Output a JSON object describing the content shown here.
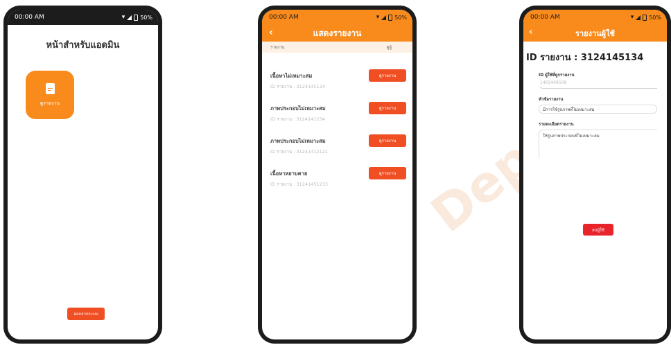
{
  "status_bar": {
    "time": "00:00 AM",
    "battery": "50%"
  },
  "screen1": {
    "title": "หน้าสำหรับแอดมิน",
    "tile_label": "ดูรายงาน",
    "logout_label": "ออกจากระบบ"
  },
  "screen2": {
    "title": "แสดงรายงาน",
    "back": "‹",
    "col_left": "รายงาน",
    "col_right": "ดูผู้",
    "reports": [
      {
        "title": "เนื้อหาไม่เหมาะสม",
        "id": "ID รายงาน : 3124145134",
        "button": "ดูรายงาน"
      },
      {
        "title": "ภาพประกอบไม่เหมาะสม",
        "id": "ID รายงาน : 3124141234",
        "button": "ดูรายงาน"
      },
      {
        "title": "ภาพประกอบไม่เหมาะสม",
        "id": "ID รายงาน : 31241412121",
        "button": "ดูรายงาน"
      },
      {
        "title": "เนื้อหาหยาบคาย",
        "id": "ID รายงาน : 31241451233",
        "button": "ดูรายงาน"
      }
    ]
  },
  "screen3": {
    "title": "รายงานผู้ใช้",
    "back": "‹",
    "heading": "ID รายงาน : 3124145134",
    "reported_user_label": "ID ผู้ใช้ที่ถูกรายงาน",
    "reported_user_value": "1403409508",
    "subject_label": "หัวข้อรายงาน",
    "subject_value": "มีการใช้รูปภาพที่ไม่เหมาะสม",
    "details_label": "รายละเอียดรายงาน",
    "details_value": "ใช้รูปภาพประกอบที่ไม่เหมาะสม",
    "ban_button": "ลบผู้ใช้"
  },
  "watermark": {
    "line1": "Department",
    "line2": "University"
  },
  "colors": {
    "orange": "#f98b1d",
    "button_red": "#f04e23",
    "ban_red": "#e8232a"
  }
}
